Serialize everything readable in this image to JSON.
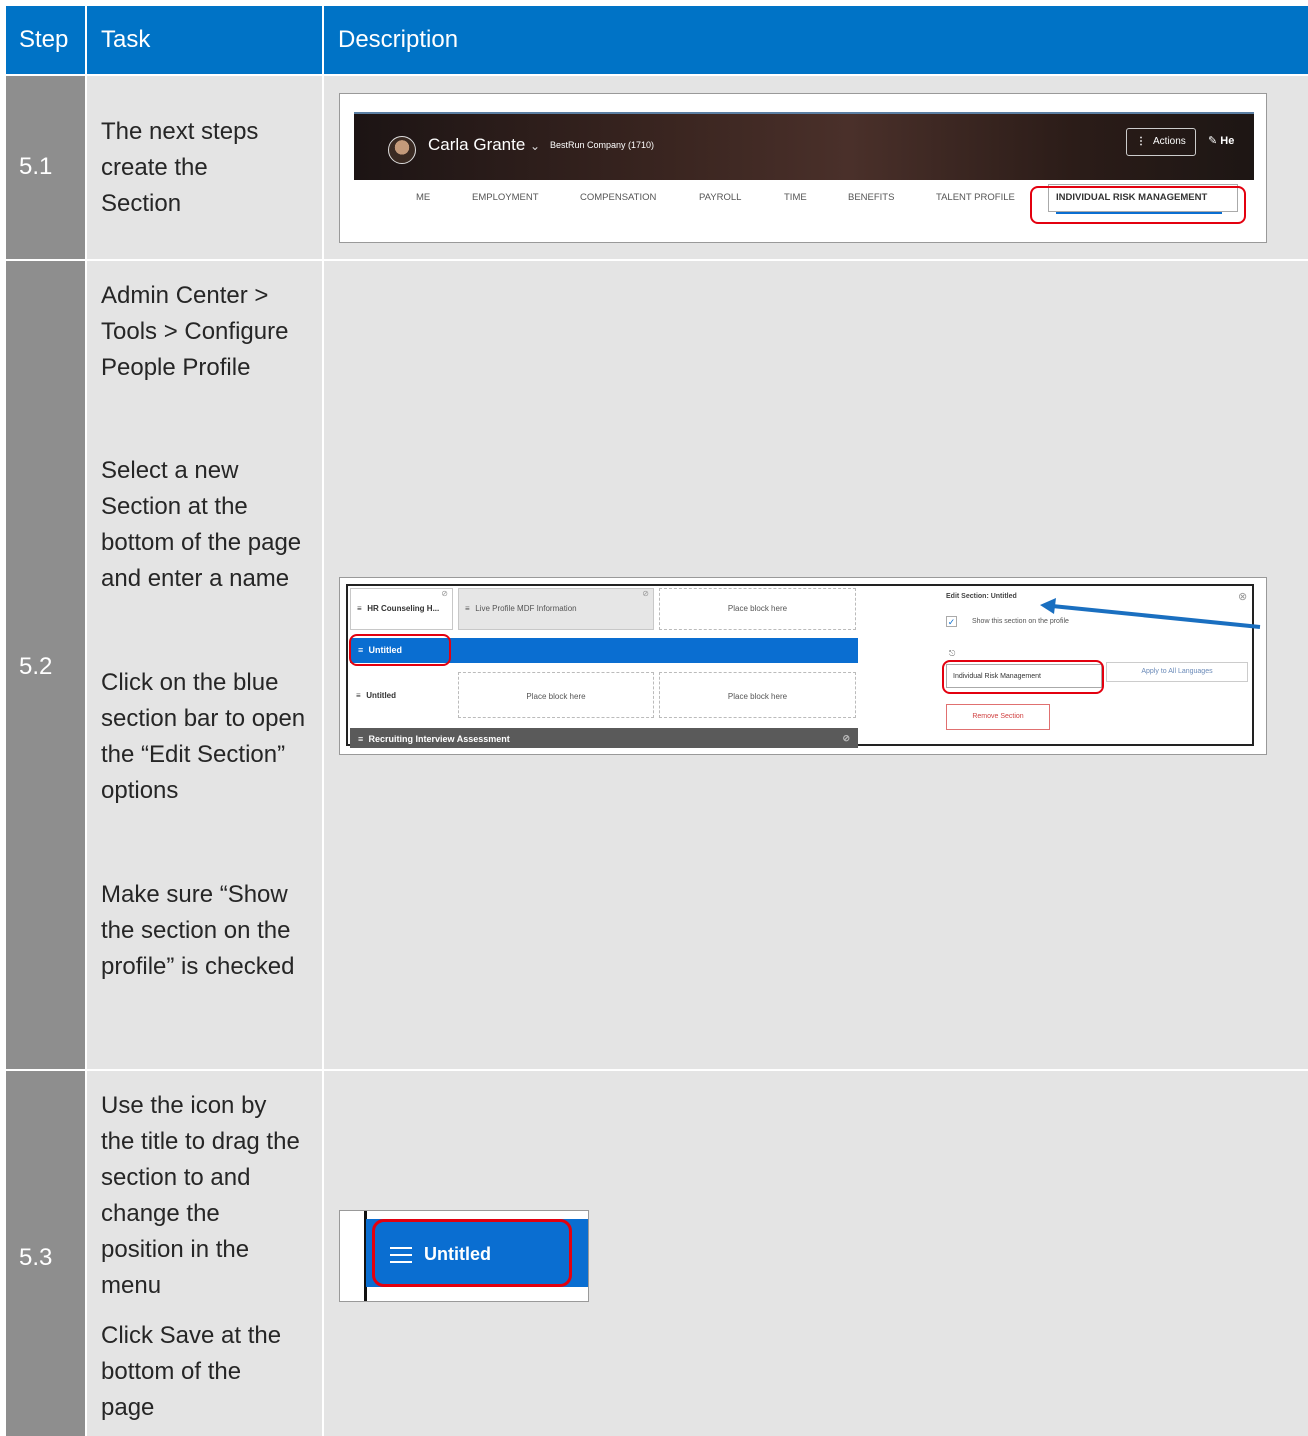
{
  "header": {
    "step": "Step",
    "task": "Task",
    "description": "Description"
  },
  "rows": [
    {
      "step": "5.1",
      "task": [
        "The next steps create the Section"
      ],
      "screenshot": {
        "user_name": "Carla Grante",
        "company": "BestRun Company (1710)",
        "actions": "Actions",
        "edit_label": "He",
        "tabs": [
          "ME",
          "EMPLOYMENT",
          "COMPENSATION",
          "PAYROLL",
          "TIME",
          "BENEFITS",
          "TALENT PROFILE",
          "INDIVIDUAL RISK MANAGEMENT"
        ]
      }
    },
    {
      "step": "5.2",
      "task": [
        "Admin Center > Tools > Configure People Profile",
        "Select a new Section at the bottom of the page and enter a name",
        "Click on the blue section bar to open the “Edit Section” options",
        "Make sure “Show the section on the profile” is checked"
      ],
      "screenshot": {
        "hr_counseling": "HR Counseling H...",
        "live_profile": "Live Profile MDF Information",
        "place_block": "Place block here",
        "untitled": "Untitled",
        "recruiting": "Recruiting Interview Assessment",
        "edit_title": "Edit Section: Untitled",
        "show_section": "Show this section on the profile",
        "name_value": "Individual Risk Management",
        "apply_all": "Apply to All Languages",
        "remove_section": "Remove Section"
      }
    },
    {
      "step": "5.3",
      "task": [
        "Use the icon by the title to drag the section to and change the position in the menu",
        "Click Save at the bottom of the page"
      ],
      "screenshot": {
        "untitled": "Untitled"
      }
    }
  ],
  "colors": {
    "header": "#0073c6",
    "step": "#8e8e8e",
    "cell": "#e4e4e4",
    "highlight": "#e3000f",
    "sap_blue": "#0a6ed1"
  }
}
